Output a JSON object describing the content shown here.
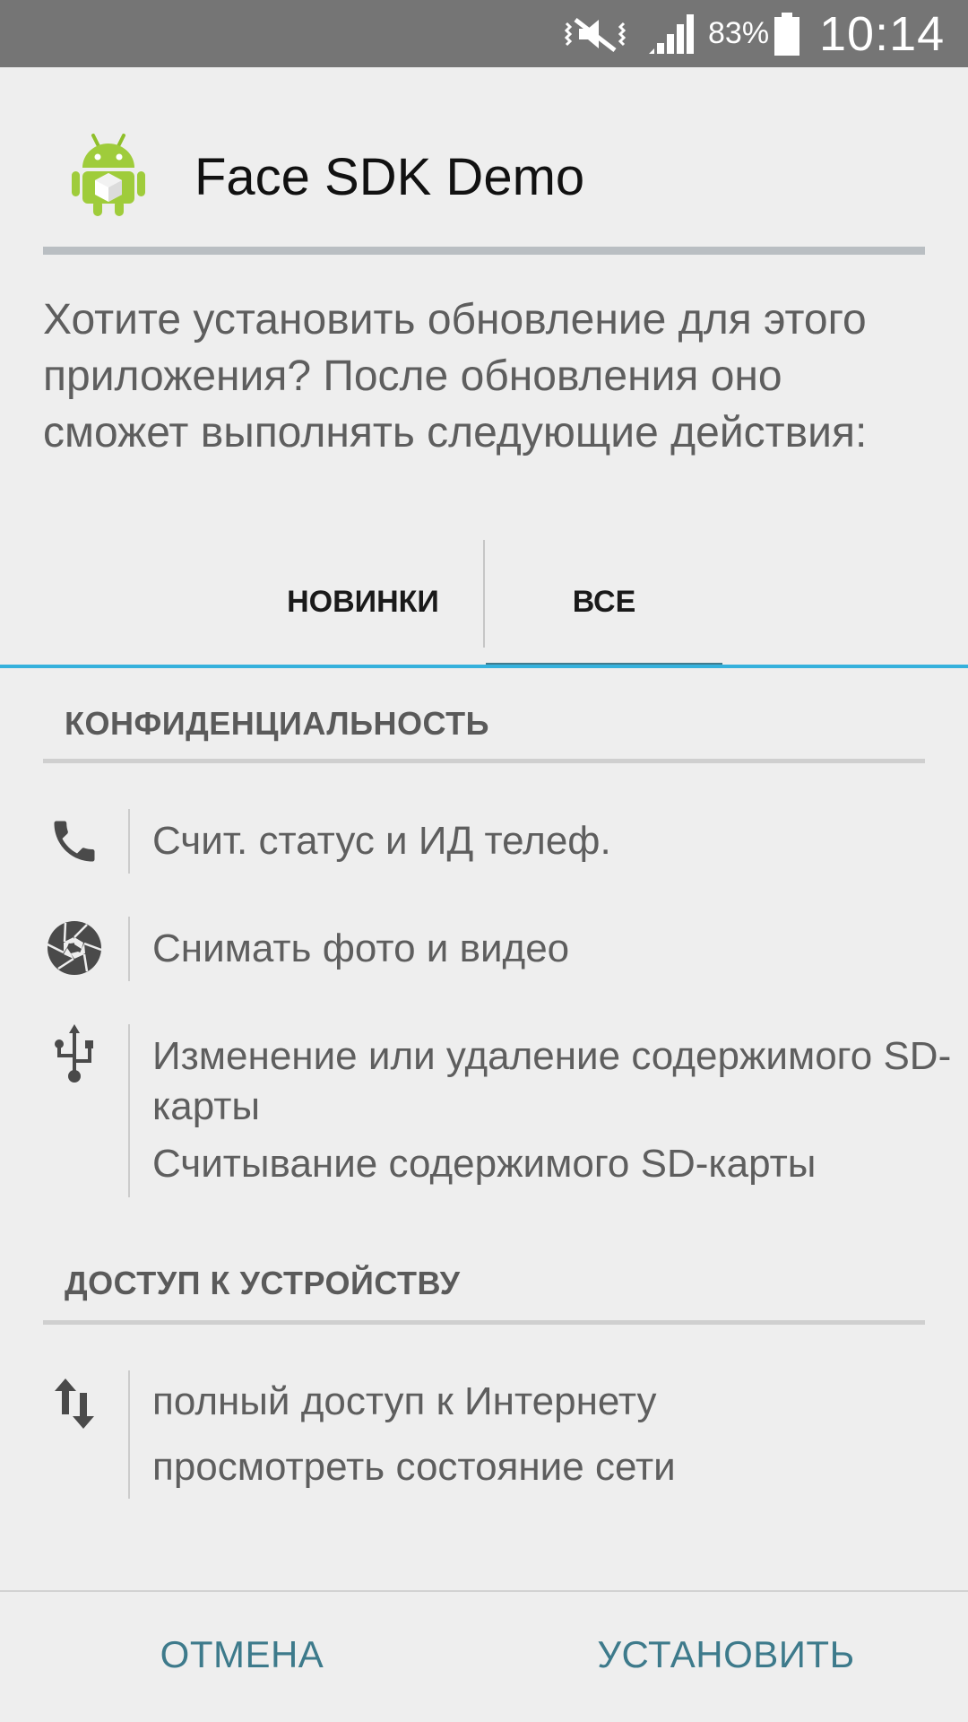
{
  "status_bar": {
    "battery_percent": "83%",
    "time": "10:14",
    "icons": [
      "mute-vibrate-icon",
      "signal-icon",
      "battery-icon"
    ]
  },
  "app": {
    "title": "Face SDK Demo",
    "icon": "android-app-icon"
  },
  "prompt": "Хотите установить обновление для этого приложения? После обновления оно сможет выполнять следующие действия:",
  "tabs": [
    {
      "label": "НОВИНКИ",
      "selected": false
    },
    {
      "label": "ВСЕ",
      "selected": true
    }
  ],
  "sections": [
    {
      "title": "КОНФИДЕНЦИАЛЬНОСТЬ",
      "items": [
        {
          "icon": "phone-icon",
          "lines": [
            "Счит. статус и ИД телеф."
          ]
        },
        {
          "icon": "camera-shutter-icon",
          "lines": [
            "Снимать фото и видео"
          ]
        },
        {
          "icon": "usb-icon",
          "lines": [
            "Изменение или удаление содержимого SD-карты",
            "Считывание содержимого SD-карты"
          ]
        }
      ]
    },
    {
      "title": "ДОСТУП К УСТРОЙСТВУ",
      "items": [
        {
          "icon": "network-arrows-icon",
          "lines": [
            "полный доступ к Интернету",
            "просмотреть состояние сети"
          ]
        }
      ]
    }
  ],
  "buttons": {
    "cancel": "ОТМЕНА",
    "install": "УСТАНОВИТЬ"
  },
  "colors": {
    "status_bar": "#757575",
    "accent": "#35b1dc",
    "button_text": "#3d7a8b",
    "tab_indicator": "#3f7b8d",
    "background": "#eeeeee"
  }
}
